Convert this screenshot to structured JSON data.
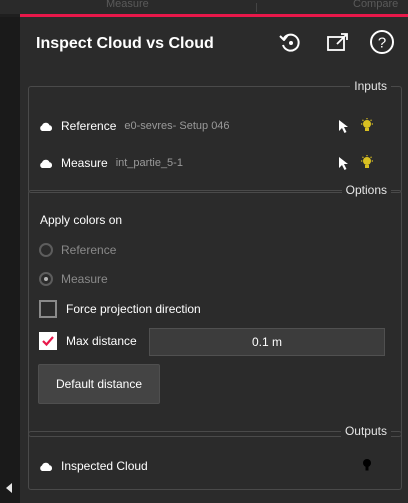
{
  "tabs": [
    {
      "label": "Measure"
    },
    {
      "label": "Compare"
    }
  ],
  "colors": {
    "accent": "#e8184a",
    "bulb": "#d9c021"
  },
  "header": {
    "title": "Inspect Cloud vs Cloud",
    "icons": [
      "reset-icon",
      "popout-icon",
      "help-icon"
    ]
  },
  "inputs": {
    "legend": "Inputs",
    "reference": {
      "label": "Reference",
      "value": "e0-sevres- Setup 046"
    },
    "measure": {
      "label": "Measure",
      "value": "int_partie_5-1"
    }
  },
  "options": {
    "legend": "Options",
    "apply_colors_label": "Apply colors on",
    "radio_reference": {
      "label": "Reference",
      "selected": false
    },
    "radio_measure": {
      "label": "Measure",
      "selected": true
    },
    "force_projection": {
      "label": "Force projection direction",
      "checked": false
    },
    "max_distance": {
      "label": "Max distance",
      "checked": true,
      "value": "0.1 m"
    },
    "default_distance_label": "Default distance"
  },
  "outputs": {
    "legend": "Outputs",
    "inspected_cloud": {
      "label": "Inspected Cloud"
    }
  }
}
